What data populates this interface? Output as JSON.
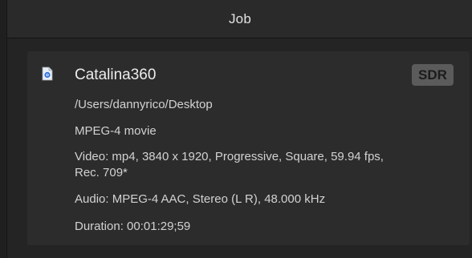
{
  "header": {
    "title": "Job"
  },
  "job": {
    "name": "Catalina360",
    "badge": "SDR",
    "icon": "quicktime-file-icon",
    "path": "/Users/dannyrico/Desktop",
    "format": "MPEG-4 movie",
    "video_line1": "Video: mp4, 3840 x 1920, Progressive, Square, 59.94 fps,",
    "video_line2": "Rec. 709*",
    "audio": "Audio: MPEG-4 AAC, Stereo (L R), 48.000 kHz",
    "duration": "Duration: 00:01:29;59"
  },
  "colors": {
    "background": "#1f1f1f",
    "header": "#2a2a2a",
    "card": "#2c2c2c",
    "badge": "#5b5b5b",
    "text": "#d2d2d2"
  }
}
